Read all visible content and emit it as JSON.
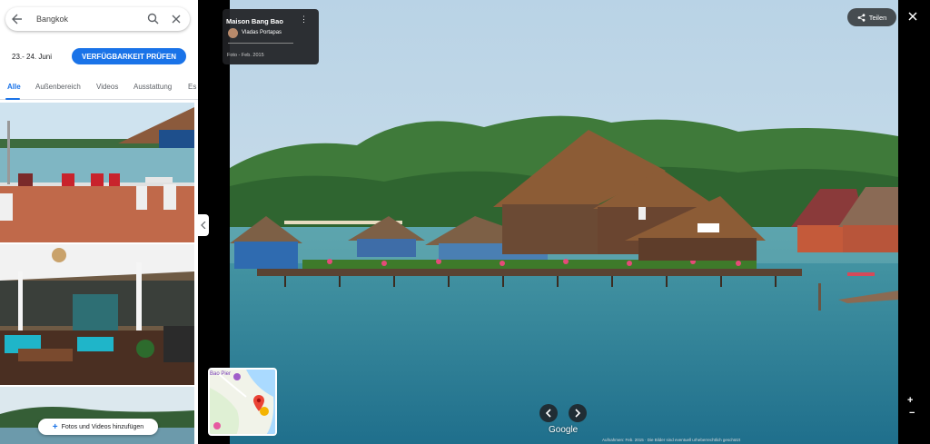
{
  "search": {
    "value": "Bangkok"
  },
  "booking": {
    "dates": "23.- 24. Juni",
    "availability_label": "VERFÜGBARKEIT PRÜFEN"
  },
  "tabs": [
    {
      "label": "Alle",
      "active": true
    },
    {
      "label": "Außenbereich"
    },
    {
      "label": "Videos"
    },
    {
      "label": "Ausstattung"
    },
    {
      "label": "Es"
    }
  ],
  "add_media": {
    "label": "Fotos und Videos hinzufügen"
  },
  "photo_info": {
    "title": "Maison Bang Bao",
    "author": "Vladas Portapas",
    "date": "Foto - Feb. 2015"
  },
  "share": {
    "label": "Teilen"
  },
  "minimap": {
    "label": "Bao Pier"
  },
  "branding": {
    "logo": "Google"
  },
  "footer": {
    "text": "Aufnahmen: Feb. 2015 · Die Bilder sind eventuell urheberrechtlich geschützt"
  },
  "zoom": {
    "in": "+",
    "out": "−"
  },
  "colors": {
    "accent": "#1a73e8",
    "panel_dark": "#202124"
  }
}
